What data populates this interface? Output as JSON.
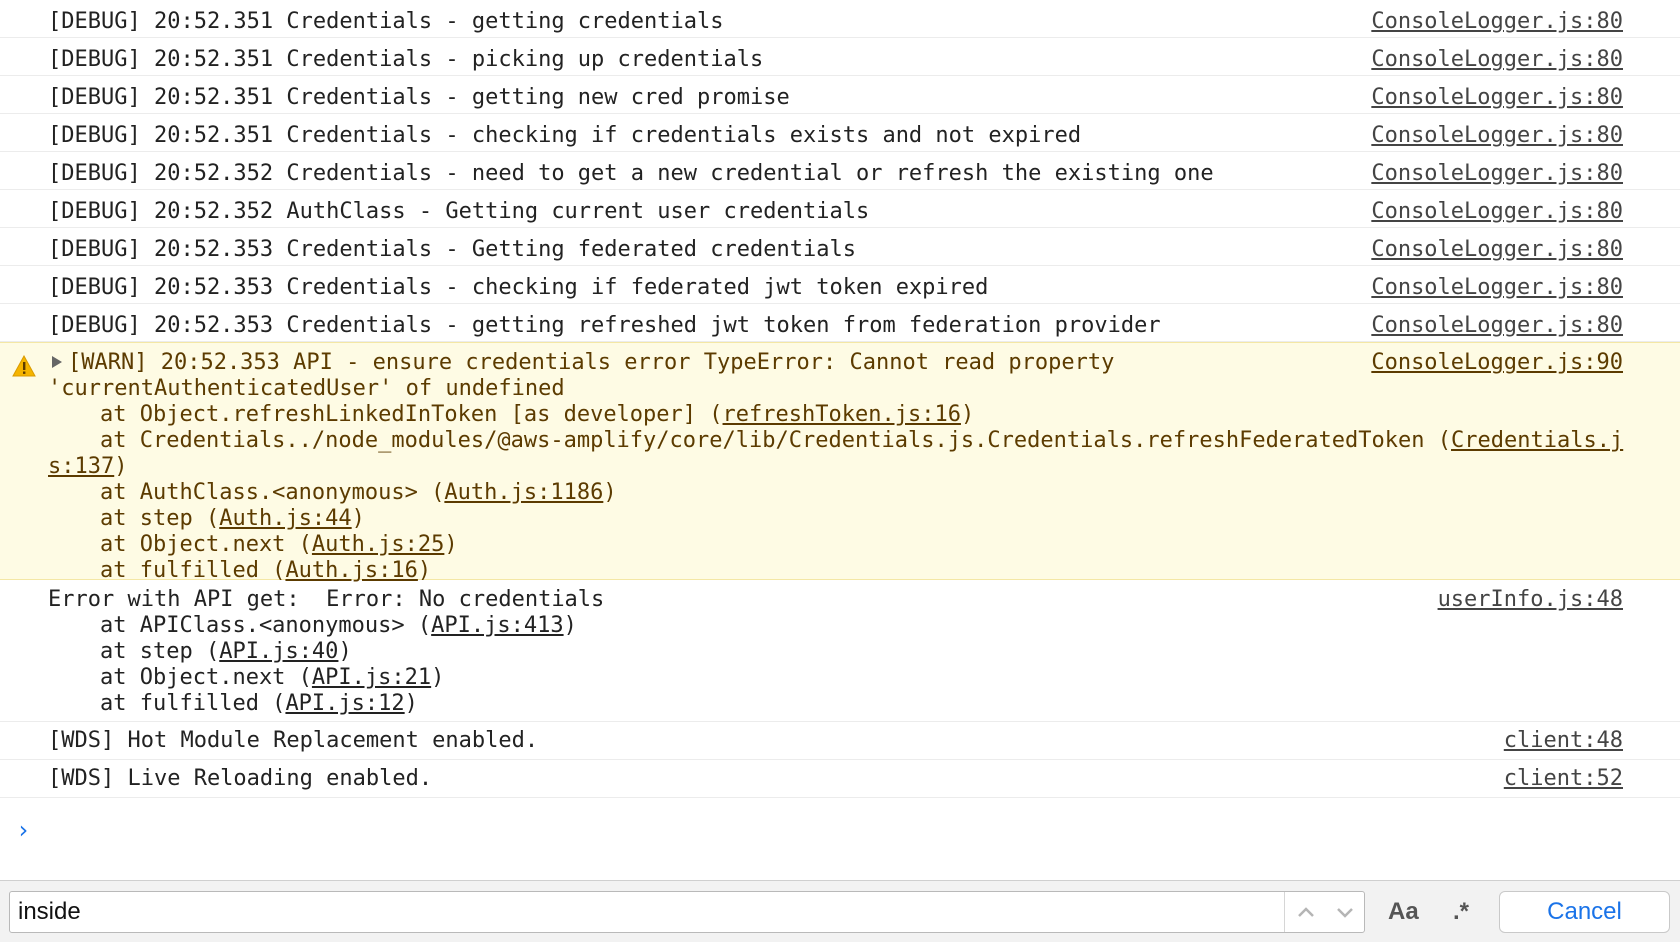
{
  "debug_rows": [
    {
      "text": "[DEBUG] 20:52.351 Credentials - getting credentials",
      "source": "ConsoleLogger.js:80"
    },
    {
      "text": "[DEBUG] 20:52.351 Credentials - picking up credentials",
      "source": "ConsoleLogger.js:80"
    },
    {
      "text": "[DEBUG] 20:52.351 Credentials - getting new cred promise",
      "source": "ConsoleLogger.js:80"
    },
    {
      "text": "[DEBUG] 20:52.351 Credentials - checking if credentials exists and not expired",
      "source": "ConsoleLogger.js:80"
    },
    {
      "text": "[DEBUG] 20:52.352 Credentials - need to get a new credential or refresh the existing one",
      "source": "ConsoleLogger.js:80"
    },
    {
      "text": "[DEBUG] 20:52.352 AuthClass - Getting current user credentials",
      "source": "ConsoleLogger.js:80"
    },
    {
      "text": "[DEBUG] 20:52.353 Credentials - Getting federated credentials",
      "source": "ConsoleLogger.js:80"
    },
    {
      "text": "[DEBUG] 20:52.353 Credentials - checking if federated jwt token expired",
      "source": "ConsoleLogger.js:80"
    },
    {
      "text": "[DEBUG] 20:52.353 Credentials - getting refreshed jwt token from federation provider",
      "source": "ConsoleLogger.js:80"
    }
  ],
  "warn": {
    "source": "ConsoleLogger.js:90",
    "line1": "[WARN] 20:52.353 API - ensure credentials error TypeError: Cannot read property",
    "line2": "'currentAuthenticatedUser' of undefined",
    "frames": [
      {
        "prefix": "at Object.refreshLinkedInToken [as developer] (",
        "link": "refreshToken.js:16",
        "suffix": ")"
      },
      {
        "prefix": "at Credentials../node_modules/@aws-amplify/core/lib/Credentials.js.Credentials.refreshFederatedToken (",
        "link": "Credentials.j",
        "suffix": ""
      },
      {
        "prefix": "",
        "link": "s:137",
        "suffix": ")"
      },
      {
        "prefix": "at AuthClass.<anonymous> (",
        "link": "Auth.js:1186",
        "suffix": ")"
      },
      {
        "prefix": "at step (",
        "link": "Auth.js:44",
        "suffix": ")"
      },
      {
        "prefix": "at Object.next (",
        "link": "Auth.js:25",
        "suffix": ")"
      },
      {
        "prefix": "at fulfilled (",
        "link": "Auth.js:16",
        "suffix": ")"
      }
    ]
  },
  "error": {
    "source": "userInfo.js:48",
    "line1": "Error with API get:  Error: No credentials",
    "frames": [
      {
        "prefix": "at APIClass.<anonymous> (",
        "link": "API.js:413",
        "suffix": ")"
      },
      {
        "prefix": "at step (",
        "link": "API.js:40",
        "suffix": ")"
      },
      {
        "prefix": "at Object.next (",
        "link": "API.js:21",
        "suffix": ")"
      },
      {
        "prefix": "at fulfilled (",
        "link": "API.js:12",
        "suffix": ")"
      }
    ]
  },
  "wds_rows": [
    {
      "text": "[WDS] Hot Module Replacement enabled.",
      "source": "client:48"
    },
    {
      "text": "[WDS] Live Reloading enabled.",
      "source": "client:52"
    }
  ],
  "prompt_symbol": "›",
  "findbar": {
    "value": "inside",
    "case_label": "Aa",
    "regex_label": ".*",
    "cancel_label": "Cancel",
    "up_icon": "chevron-up-icon",
    "down_icon": "chevron-down-icon"
  },
  "colors": {
    "warn_bg": "#fefbe4",
    "accent": "#1a73e8",
    "warn_text": "#5c3b00"
  }
}
